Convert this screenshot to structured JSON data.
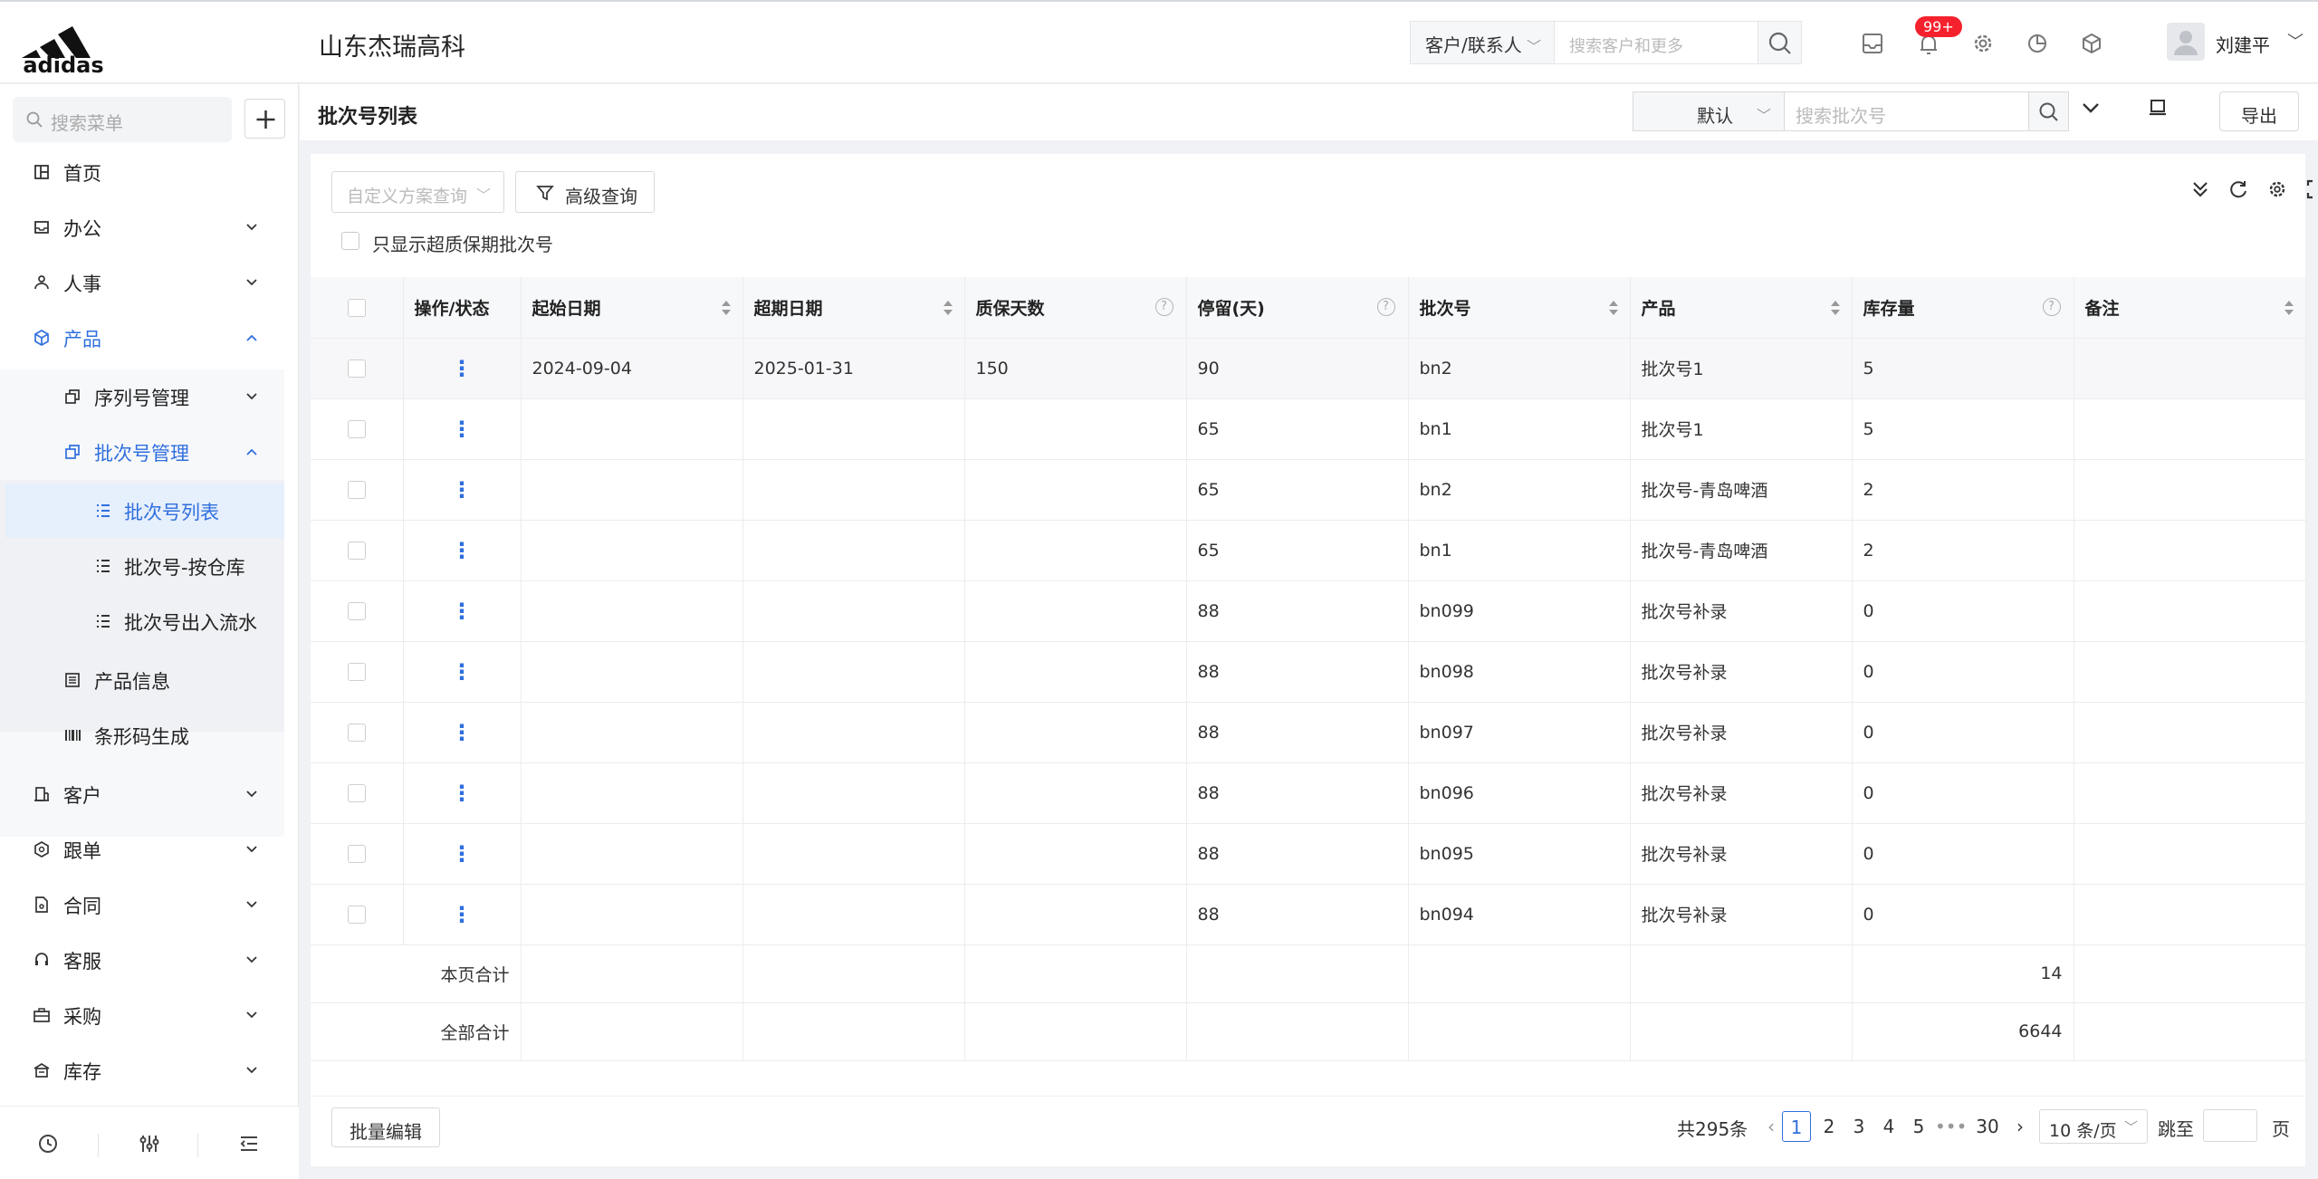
{
  "header": {
    "logo_text": "adidas",
    "company": "山东杰瑞高科",
    "search_scope": "客户/联系人",
    "search_placeholder": "搜索客户和更多",
    "notification_badge": "99+",
    "username": "刘建平"
  },
  "sidebar": {
    "search_placeholder": "搜索菜单",
    "items": [
      {
        "label": "首页"
      },
      {
        "label": "办公"
      },
      {
        "label": "人事"
      },
      {
        "label": "产品"
      },
      {
        "label": "序列号管理"
      },
      {
        "label": "批次号管理"
      },
      {
        "label": "批次号列表"
      },
      {
        "label": "批次号-按仓库"
      },
      {
        "label": "批次号出入流水"
      },
      {
        "label": "产品信息"
      },
      {
        "label": "条形码生成"
      },
      {
        "label": "客户"
      },
      {
        "label": "跟单"
      },
      {
        "label": "合同"
      },
      {
        "label": "客服"
      },
      {
        "label": "采购"
      },
      {
        "label": "库存"
      }
    ]
  },
  "page": {
    "title": "批次号列表",
    "scheme": "默认",
    "search_placeholder": "搜索批次号",
    "export_label": "导出",
    "custom_query_placeholder": "自定义方案查询",
    "advanced_query_label": "高级查询",
    "only_expired_label": "只显示超质保期批次号"
  },
  "table": {
    "headers": [
      "操作/状态",
      "起始日期",
      "超期日期",
      "质保天数",
      "停留(天)",
      "批次号",
      "产品",
      "库存量",
      "备注"
    ],
    "rows": [
      {
        "start": "2024-09-04",
        "end": "2025-01-31",
        "warranty": "150",
        "stay": "90",
        "batch": "bn2",
        "product": "批次号1",
        "stock": "5",
        "note": ""
      },
      {
        "start": "",
        "end": "",
        "warranty": "",
        "stay": "65",
        "batch": "bn1",
        "product": "批次号1",
        "stock": "5",
        "note": ""
      },
      {
        "start": "",
        "end": "",
        "warranty": "",
        "stay": "65",
        "batch": "bn2",
        "product": "批次号-青岛啤酒",
        "stock": "2",
        "note": ""
      },
      {
        "start": "",
        "end": "",
        "warranty": "",
        "stay": "65",
        "batch": "bn1",
        "product": "批次号-青岛啤酒",
        "stock": "2",
        "note": ""
      },
      {
        "start": "",
        "end": "",
        "warranty": "",
        "stay": "88",
        "batch": "bn099",
        "product": "批次号补录",
        "stock": "0",
        "note": ""
      },
      {
        "start": "",
        "end": "",
        "warranty": "",
        "stay": "88",
        "batch": "bn098",
        "product": "批次号补录",
        "stock": "0",
        "note": ""
      },
      {
        "start": "",
        "end": "",
        "warranty": "",
        "stay": "88",
        "batch": "bn097",
        "product": "批次号补录",
        "stock": "0",
        "note": ""
      },
      {
        "start": "",
        "end": "",
        "warranty": "",
        "stay": "88",
        "batch": "bn096",
        "product": "批次号补录",
        "stock": "0",
        "note": ""
      },
      {
        "start": "",
        "end": "",
        "warranty": "",
        "stay": "88",
        "batch": "bn095",
        "product": "批次号补录",
        "stock": "0",
        "note": ""
      },
      {
        "start": "",
        "end": "",
        "warranty": "",
        "stay": "88",
        "batch": "bn094",
        "product": "批次号补录",
        "stock": "0",
        "note": ""
      }
    ],
    "page_total_label": "本页合计",
    "page_total_stock": "14",
    "all_total_label": "全部合计",
    "all_total_stock": "6644"
  },
  "footer": {
    "bulk_edit_label": "批量编辑",
    "total_text": "共295条",
    "pages": [
      "1",
      "2",
      "3",
      "4",
      "5"
    ],
    "ellipsis": "•••",
    "last_page": "30",
    "page_size": "10 条/页",
    "jump_label": "跳至",
    "page_label": "页"
  },
  "colors": {
    "accent": "#2f6fde",
    "badge": "#f5222d"
  }
}
